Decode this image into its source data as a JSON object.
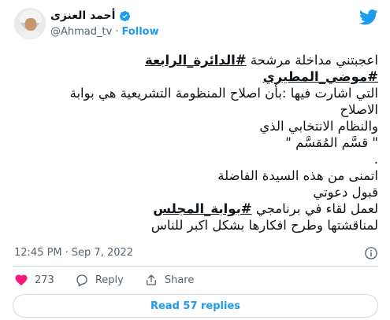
{
  "header": {
    "display_name": "أحمد العنزى",
    "handle": "@Ahmad_tv",
    "separator": "·",
    "follow_label": "Follow"
  },
  "icons": {
    "verified": "verified-badge-icon",
    "brand": "twitter-bird-icon",
    "info": "info-icon",
    "like": "heart-icon",
    "reply": "reply-bubble-icon",
    "share": "share-icon"
  },
  "tweet": {
    "lines": [
      {
        "before": "اعجبتني مداخلة مرشحة ",
        "hashtag": "#الدائرة_الرابعة",
        "after": ""
      },
      {
        "before": "",
        "hashtag": "#موضي_المطيري",
        "after": ""
      },
      {
        "before": "التي اشارت فيها :بأن اصلاح المنظومة التشريعية هي بوابة",
        "hashtag": "",
        "after": ""
      },
      {
        "before": "الاصلاح",
        "hashtag": "",
        "after": ""
      },
      {
        "before": "والنظام الانتخابي الذي",
        "hashtag": "",
        "after": ""
      },
      {
        "before": "\" قسَّم المُقسَّم \"",
        "hashtag": "",
        "after": ""
      },
      {
        "before": ".",
        "hashtag": "",
        "after": ""
      },
      {
        "before": "اتمنى من هذه السيدة الفاضلة",
        "hashtag": "",
        "after": ""
      },
      {
        "before": " قبول دعوتي",
        "hashtag": "",
        "after": ""
      },
      {
        "before": "لعمل لقاء في برنامجي ",
        "hashtag": "#بوابة_المجلس",
        "after": ""
      },
      {
        "before": "لمناقشتها وطرح افكارها بشكل اكبر للناس",
        "hashtag": "",
        "after": ""
      }
    ]
  },
  "meta": {
    "time": "12:45 PM",
    "separator": "·",
    "date": "Sep 7, 2022"
  },
  "actions": {
    "like_count": "273",
    "reply_label": "Reply",
    "share_label": "Share"
  },
  "read_replies_label": "Read 57 replies",
  "colors": {
    "accent": "#1d9bf0",
    "like_red": "#f91880",
    "text": "#0f1419",
    "muted": "#536471",
    "border": "#cfd9de"
  }
}
